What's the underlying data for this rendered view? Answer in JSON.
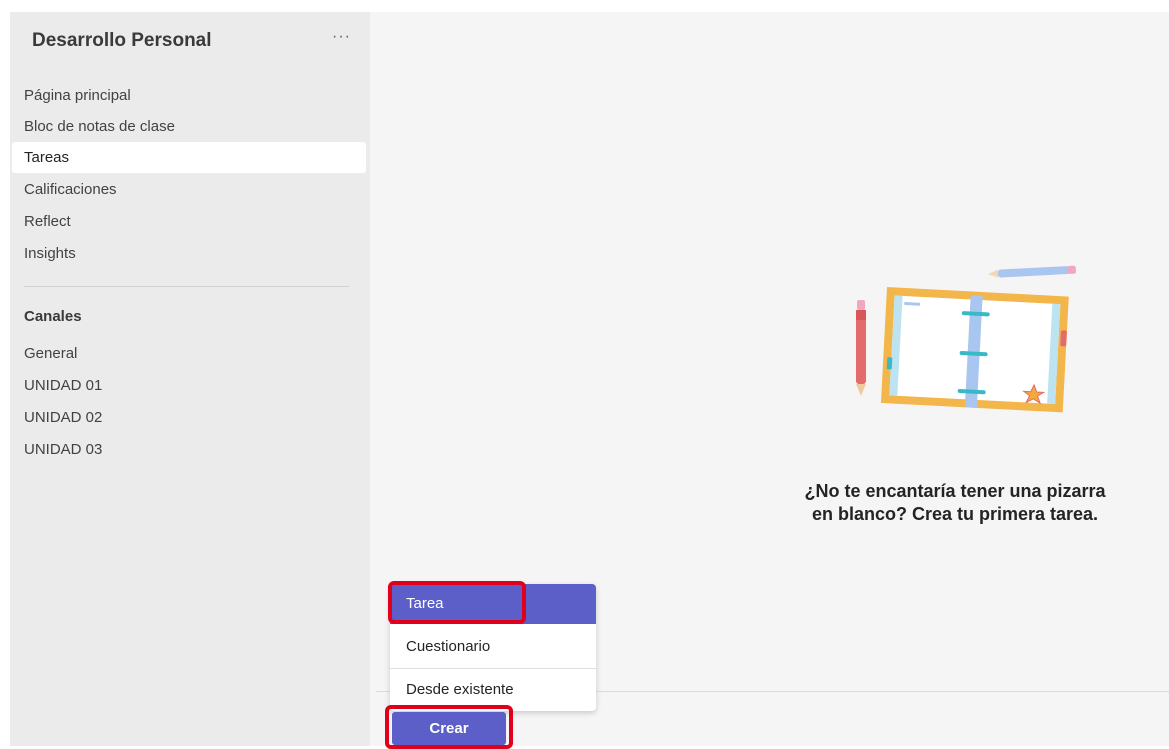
{
  "sidebar": {
    "team_name": "Desarrollo Personal",
    "more_label": "···",
    "items": [
      {
        "label": "Página principal"
      },
      {
        "label": "Bloc de notas de clase"
      },
      {
        "label": "Tareas",
        "active": true
      },
      {
        "label": "Calificaciones"
      },
      {
        "label": "Reflect"
      },
      {
        "label": "Insights"
      }
    ],
    "channels_title": "Canales",
    "channels": [
      {
        "label": "General"
      },
      {
        "label": "UNIDAD 01"
      },
      {
        "label": "UNIDAD 02"
      },
      {
        "label": "UNIDAD 03"
      }
    ]
  },
  "main": {
    "empty_state_line1": "¿No te encantaría tener una pizarra",
    "empty_state_line2": "en blanco? Crea tu primera tarea.",
    "illustration_icon": "notebook-illustration-icon"
  },
  "create_menu": {
    "items": [
      {
        "label": "Tarea",
        "selected": true
      },
      {
        "label": "Cuestionario"
      },
      {
        "label": "Desde existente"
      }
    ],
    "create_label": "Crear"
  },
  "colors": {
    "accent": "#5b5fc7",
    "highlight": "#e0001b",
    "sidebar_bg": "#ebebeb",
    "main_bg": "#f5f5f5"
  }
}
